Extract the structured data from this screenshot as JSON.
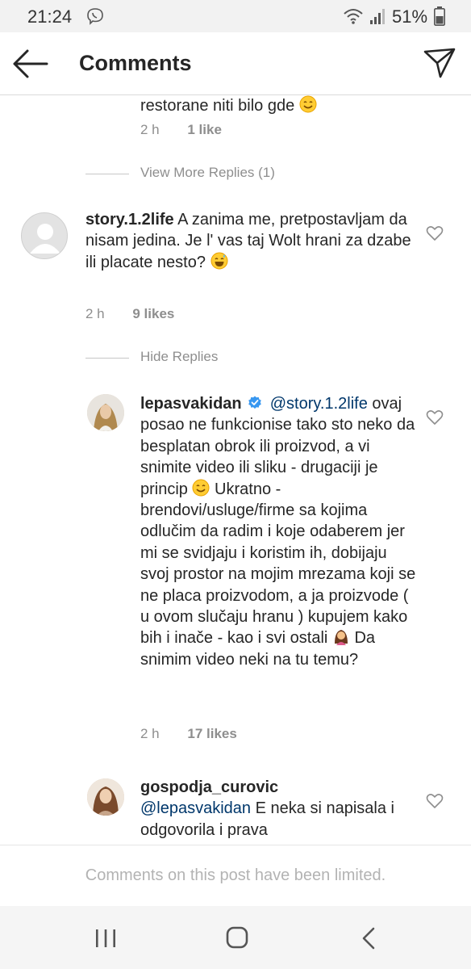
{
  "status_bar": {
    "time": "21:24",
    "battery": "51%"
  },
  "header": {
    "title": "Comments"
  },
  "thread_top": {
    "cut_text": "restorane niti bilo gde",
    "time": "2 h",
    "likes": "1 like"
  },
  "view_more_replies": "View More Replies (1)",
  "comment1": {
    "username": "story.1.2life",
    "text": "A zanima me, pretpostavljam da nisam jedina. Je l' vas taj Wolt hrani za dzabe ili placate nesto?",
    "time": "2 h",
    "likes": "9 likes"
  },
  "hide_replies": "Hide Replies",
  "reply1": {
    "username": "lepasvakidan",
    "mention": "@story.1.2life",
    "text_part1": "ovaj posao ne funkcionise tako sto neko da besplatan obrok ili proizvod, a vi snimite video ili sliku - drugaciji je princip",
    "text_part2": "Ukratno - brendovi/usluge/firme sa kojima odlučim da radim i koje odaberem jer mi se svidjaju i koristim ih, dobijaju svoj prostor na mojim mrezama koji se ne placa proizvodom, a ja proizvode ( u ovom slučaju hranu ) kupujem kako bih i inače - kao i svi ostali",
    "text_part3": "Da snimim video neki na tu temu?",
    "time": "2 h",
    "likes": "17 likes"
  },
  "reply2": {
    "username": "gospodja_curovic",
    "mention": "@lepasvakidan",
    "text": "E neka si napisala i odgovorila i prava"
  },
  "footer": {
    "limited_text": "Comments on this post have been limited."
  },
  "colors": {
    "mention": "#00376b",
    "verified": "#3897f0",
    "meta": "#8e8e8e"
  },
  "icons": [
    "back-arrow-icon",
    "direct-send-icon",
    "heart-icon",
    "verified-badge-icon",
    "smiling-emoji-icon",
    "sweat-smile-emoji-icon",
    "shrug-woman-emoji-icon"
  ]
}
